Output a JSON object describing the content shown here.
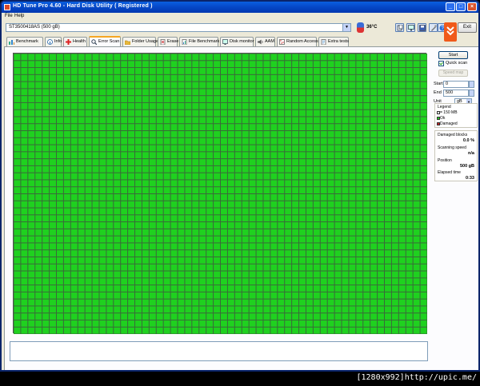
{
  "window": {
    "title": "HD Tune Pro 4.60 - Hard Disk Utility ( Registered )"
  },
  "menu": {
    "file": "File",
    "help": "Help"
  },
  "toolbar": {
    "drive": "ST3500418AS (500 gB)",
    "temperature": "36°C",
    "exit_label": "Exit",
    "icons": [
      "copy-info-icon",
      "copy-screen-icon",
      "save-icon",
      "options-icon",
      "help-icon"
    ]
  },
  "tabs": [
    {
      "label": "Benchmark",
      "icon": "benchmark-icon"
    },
    {
      "label": "Info",
      "icon": "info-icon"
    },
    {
      "label": "Health",
      "icon": "health-icon"
    },
    {
      "label": "Error Scan",
      "icon": "error-scan-icon",
      "active": true
    },
    {
      "label": "Folder Usage",
      "icon": "folder-icon"
    },
    {
      "label": "Erase",
      "icon": "erase-icon"
    },
    {
      "label": "File Benchmark",
      "icon": "file-benchmark-icon"
    },
    {
      "label": "Disk monitor",
      "icon": "disk-monitor-icon"
    },
    {
      "label": "AAM",
      "icon": "aam-icon"
    },
    {
      "label": "Random Access",
      "icon": "random-access-icon"
    },
    {
      "label": "Extra tests",
      "icon": "extra-tests-icon"
    }
  ],
  "scan": {
    "start_label": "Start",
    "quick_scan_label": "Quick scan",
    "quick_scan_checked": true,
    "speed_map_label": "Speed map",
    "start_field_label": "Start",
    "start_value": "0",
    "end_field_label": "End",
    "end_value": "500",
    "unit_label": "Unit",
    "unit_value": "gB",
    "grid": {
      "cols": 58,
      "rows": 40,
      "ok_color": "#1fd11f",
      "damaged_color": "#cc2222"
    }
  },
  "legend": {
    "title": "Legend",
    "block_size": "= 150 MB",
    "ok": "Ok",
    "damaged": "Damaged"
  },
  "stats": {
    "damaged_blocks_label": "Damaged blocks",
    "damaged_blocks_value": "0.0 %",
    "scanning_speed_label": "Scanning speed",
    "scanning_speed_value": "n/a",
    "position_label": "Position",
    "position_value": "500 gB",
    "elapsed_label": "Elapsed time",
    "elapsed_value": "0:33"
  },
  "caption": "[1280x992]http://upic.me/"
}
